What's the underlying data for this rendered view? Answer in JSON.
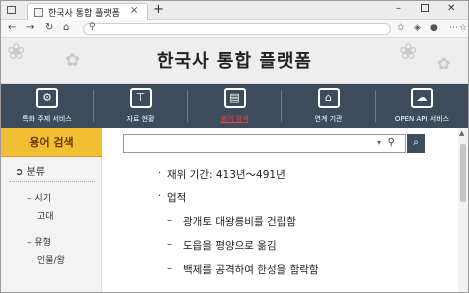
{
  "browser": {
    "tab_title": "한국사 통합 플랫폼",
    "tab_close": "×",
    "new_tab": "+",
    "url_search_icon": "search-icon",
    "window_min": "–",
    "window_close": "✕"
  },
  "header": {
    "title": "한국사 통합 플랫폼"
  },
  "nav": {
    "items": [
      {
        "label": "특화 주제 서비스",
        "icon": "gear-person-icon"
      },
      {
        "label": "자료 현황",
        "icon": "hierarchy-icon"
      },
      {
        "label": "용어 검색",
        "icon": "book-icon"
      },
      {
        "label": "연계 기관",
        "icon": "building-icon"
      },
      {
        "label": "OPEN API 서비스",
        "icon": "computer-cloud-icon"
      }
    ],
    "active_index": 2
  },
  "sidebar": {
    "header": "용어 검색",
    "category": "분류",
    "category_icon": "circle-arrow-icon",
    "groups": [
      {
        "title": "– 시기",
        "value": "고대"
      },
      {
        "title": "– 유형",
        "value": "인물/왕"
      }
    ]
  },
  "main": {
    "search_value": "",
    "lines": [
      {
        "bullet": "·",
        "text": "재위 기간: 413년～491년"
      },
      {
        "bullet": "·",
        "text": "업적"
      },
      {
        "bullet": "–",
        "text": "광개토 대왕릉비를 건립함"
      },
      {
        "bullet": "–",
        "text": "도읍을 평양으로 옮김"
      },
      {
        "bullet": "–",
        "text": "백제를 공격하여 한성을 함락함"
      }
    ]
  }
}
